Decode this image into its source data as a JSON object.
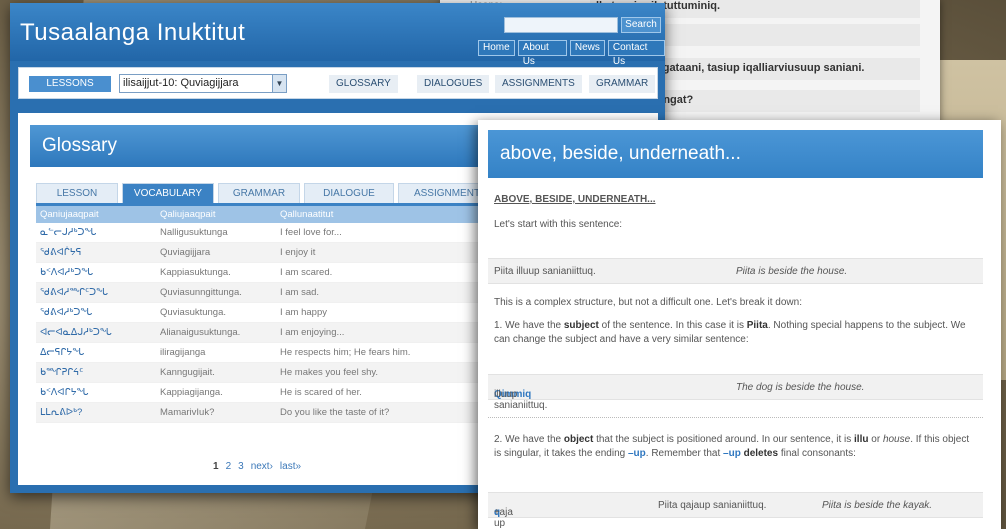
{
  "colors": {
    "brand_blue": "#2a6fb0",
    "accent_blue": "#3b82c4",
    "link_blue": "#2f77c0"
  },
  "back_window": {
    "label_top": "Haapa:",
    "rows": [
      "ll atausirmik tuttuminiq.",
      "",
      "ngataani, tasiup iqalliarviusuup saniani.",
      "irngat?"
    ]
  },
  "header": {
    "title": "Tusaalanga Inuktitut",
    "search_value": "",
    "search_button": "Search",
    "links": [
      "Home",
      "About Us",
      "News",
      "Contact Us"
    ]
  },
  "nav": {
    "lessons_label": "LESSONS",
    "lesson_select": "ilisaijjut-10: Quviagijjara",
    "links": [
      "GLOSSARY",
      "DIALOGUES",
      "ASSIGNMENTS",
      "GRAMMAR"
    ]
  },
  "glossary": {
    "title": "Glossary",
    "tabs": [
      "LESSON",
      "VOCABULARY",
      "GRAMMAR",
      "DIALOGUE",
      "ASSIGNMENT"
    ],
    "columns": [
      "Qaniujaaqpait",
      "Qaliujaaqpait",
      "Qallunaatitut"
    ],
    "rows": [
      [
        "ᓇᓪᓕᒍᓱᒃᑐᖓ",
        "Nalligusuktunga",
        "I feel love for..."
      ],
      [
        "ᖁᕕᐊᒌᔭᕋ",
        "Quviagijjara",
        "I enjoy it"
      ],
      [
        "ᑲᑉᐱᐊᓱᒃᑐᖓ",
        "Kappiasuktunga.",
        "I am scared."
      ],
      [
        "ᖁᕕᐊᓱᙱᑦᑐᖓ",
        "Quviasunngittunga.",
        "I am sad."
      ],
      [
        "ᖁᕕᐊᓱᒃᑐᖓ",
        "Quviasuktunga.",
        "I am happy"
      ],
      [
        "ᐊᓕᐊᓇᐃᒍᓱᒃᑐᖓ",
        "Alianaigusuktunga.",
        "I am enjoying..."
      ],
      [
        "ᐃᓕᕋᒋᔭᖓ",
        "iliragijanga",
        "He respects him; He fears him."
      ],
      [
        "ᑲᙱᕈᒋᔦᑦ",
        "Kanngugijait.",
        "He makes you feel shy."
      ],
      [
        "ᑲᑉᐱᐊᒋᔭᖓ",
        "Kappiagijanga.",
        "He is scared of her."
      ],
      [
        "ᒪᒪᕆᕕᐅᒃ?",
        "MamarivIuk?",
        "Do you like the taste of it?"
      ]
    ],
    "pager": {
      "pages": [
        "1",
        "2",
        "3"
      ],
      "next": "next›",
      "last": "last»"
    }
  },
  "article": {
    "title": "above, beside, underneath...",
    "subtitle": "ABOVE, BESIDE, UNDERNEATH...",
    "intro": "Let's start with this sentence:",
    "ex1": {
      "inuk": "Piita illuup sanianiittuq.",
      "en": "Piita is beside the house."
    },
    "complex": "This is a complex structure, but not a difficult one. Let's break it down:",
    "p1": {
      "a": "1. We have the ",
      "b": "subject",
      "c": " of the sentence. In this case it is ",
      "d": "Piita",
      "e": ". Nothing special happens to the subject. We can change the subject and have a very similar sentence:"
    },
    "ex2": {
      "hl": "Qimmiq",
      "inuk": " illuup sanianiittuq.",
      "en": "The dog is beside the house."
    },
    "p2": {
      "a": "2. We have the ",
      "b": "object",
      "c": " that the subject is positioned around. In our sentence, it is ",
      "d": "illu",
      "e": " or ",
      "f": "house",
      "g": ". If this object is singular, it takes the ending ",
      "h": "–up",
      "i": ". Remember that ",
      "j": "–up",
      "k": " ",
      "l": "deletes",
      "m": " final consonants:"
    },
    "ex3": {
      "a": "qaja",
      "b": "q",
      "c": " + up =",
      "inuk": "Piita qajaup sanianiittuq.",
      "en": "Piita is beside the kayak."
    }
  }
}
